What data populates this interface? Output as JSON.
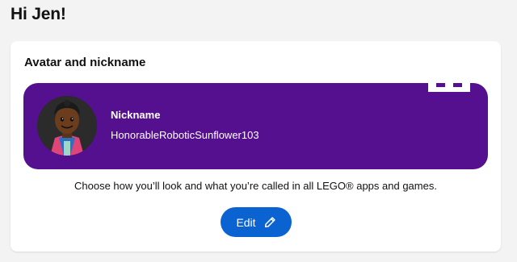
{
  "header": {
    "greeting": "Hi Jen!"
  },
  "card": {
    "title": "Avatar and nickname",
    "nickname_label": "Nickname",
    "nickname_value": "HonorableRoboticSunflower103",
    "description": "Choose how you’ll look and what you’re called in all LEGO® apps and games.",
    "edit_label": "Edit",
    "avatar_icon": "avatar-minifigure-icon",
    "edit_icon": "pencil-icon"
  },
  "colors": {
    "banner": "#55108f",
    "button": "#0b63d1",
    "background": "#f3f3f3"
  }
}
